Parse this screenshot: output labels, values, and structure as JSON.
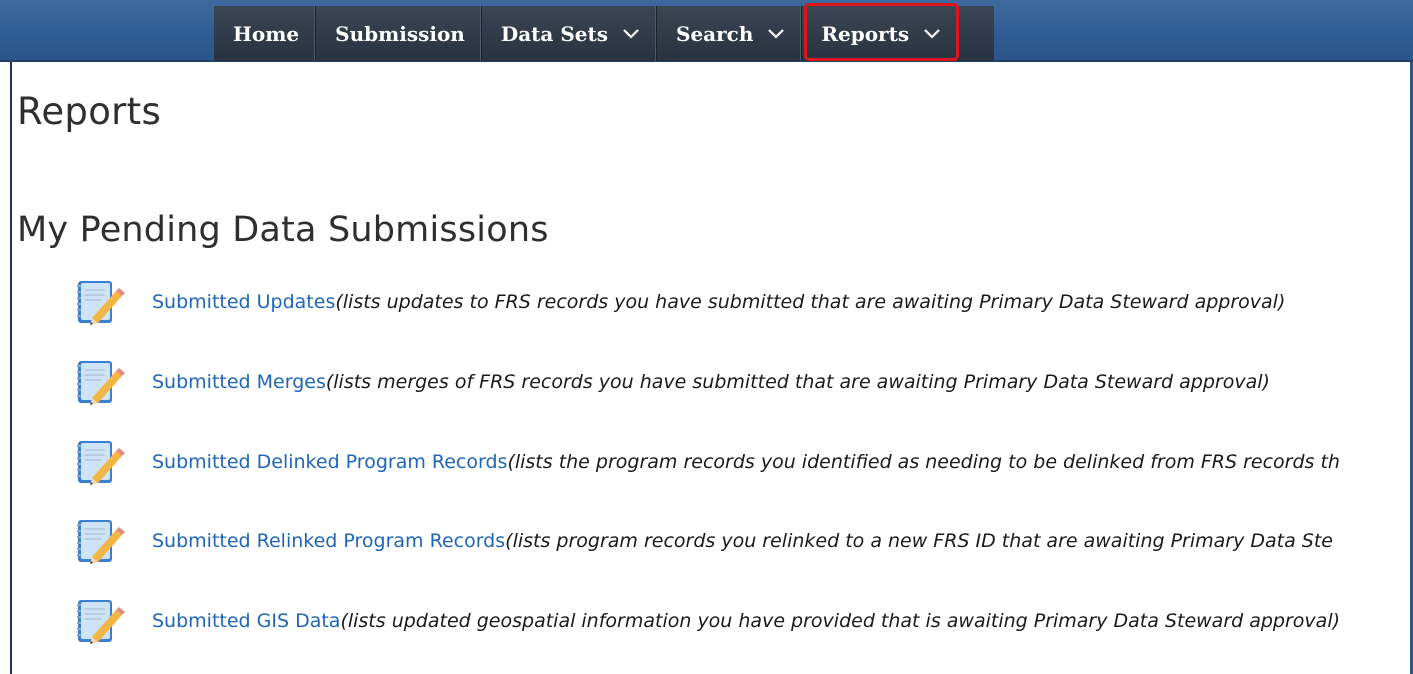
{
  "nav": {
    "items": [
      {
        "label": "Home",
        "dropdown": false
      },
      {
        "label": "Submission",
        "dropdown": false
      },
      {
        "label": "Data Sets",
        "dropdown": true
      },
      {
        "label": "Search",
        "dropdown": true
      },
      {
        "label": "Reports",
        "dropdown": true,
        "highlighted": true
      }
    ]
  },
  "page": {
    "title": "Reports",
    "section_title": "My Pending Data Submissions"
  },
  "reports": [
    {
      "link": "Submitted Updates",
      "description": "(lists updates to FRS records you have submitted that are awaiting Primary Data Steward approval)",
      "icon": "notepad-pencil-icon"
    },
    {
      "link": "Submitted Merges",
      "description": "(lists merges of FRS records you have submitted that are awaiting Primary Data Steward approval)",
      "icon": "notepad-pencil-icon"
    },
    {
      "link": "Submitted Delinked Program Records",
      "description": "(lists the program records you identified as needing to be delinked from FRS records th",
      "icon": "notepad-pencil-icon"
    },
    {
      "link": "Submitted Relinked Program Records",
      "description": "(lists program records you relinked to a new FRS ID that are awaiting Primary Data Ste",
      "icon": "notepad-pencil-icon"
    },
    {
      "link": "Submitted GIS Data",
      "description": "(lists updated geospatial information you have provided that is awaiting Primary Data Steward approval)",
      "icon": "notepad-pencil-icon"
    }
  ],
  "colors": {
    "topbar": "#2f5d94",
    "navbar": "#2f3b48",
    "link": "#2066b8",
    "highlight_outline": "#e0141b"
  }
}
